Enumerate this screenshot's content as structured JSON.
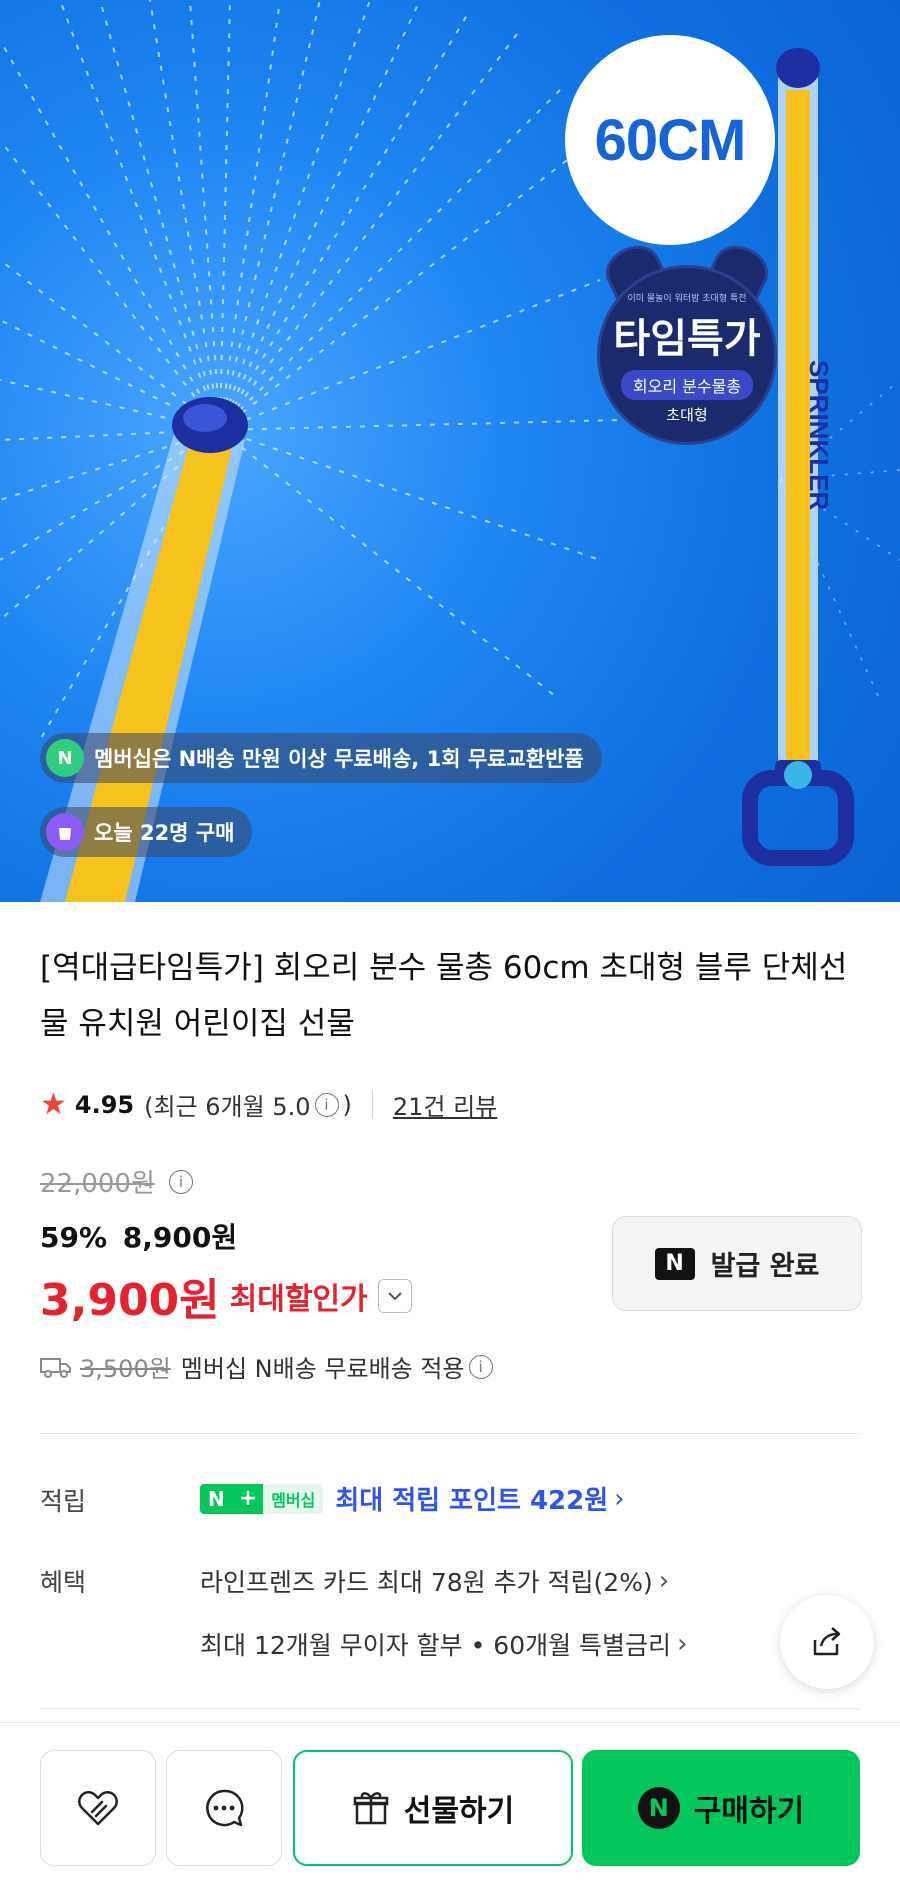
{
  "hero": {
    "size_label": "60CM",
    "badge": {
      "small_text": "이미 물놀이 워터밤 초대형 특전",
      "title": "타임특가",
      "pill": "회오리 분수물총",
      "sub": "초대형"
    },
    "tube_text": "SPRINKLER",
    "chip_membership": "멤버십은 N배송 만원 이상 무료배송, 1회 무료교환반품",
    "chip_membership_icon": "N",
    "chip_buyers": "오늘 22명 구매"
  },
  "product": {
    "title": "[역대급타임특가] 회오리 분수 물총 60cm 초대형 블루 단체선물 유치원 어린이집 선물",
    "rating": "4.95",
    "rating_recent_prefix": "(최근 6개월 5.0",
    "rating_recent_suffix": ")",
    "reviews": "21건 리뷰",
    "original_price": "22,000원",
    "discount_percent": "59%",
    "discount_price": "8,900원",
    "max_price": "3,900원",
    "max_label": "최대할인가",
    "coupon_label": "발급 완료",
    "coupon_icon": "N",
    "shipping_original": "3,500원",
    "shipping_text": "멤버십 N배송 무료배송 적용"
  },
  "benefits": {
    "points_label": "적립",
    "badge_n": "N",
    "badge_plus": "+",
    "badge_member": "멤버십",
    "points_text": "최대 적립 포인트 422원",
    "benefit_label": "혜택",
    "card_text": "라인프렌즈 카드 최대 78원 추가 적립(2%)",
    "installment_text": "최대 12개월 무이자 할부 • 60개월 특별금리"
  },
  "bottom_bar": {
    "gift_label": "선물하기",
    "buy_label": "구매하기",
    "buy_icon": "N"
  },
  "colors": {
    "accent_green": "#03c75a",
    "price_red": "#e5232f",
    "points_blue": "#2f54eb",
    "hero_blue": "#1f86f2"
  }
}
